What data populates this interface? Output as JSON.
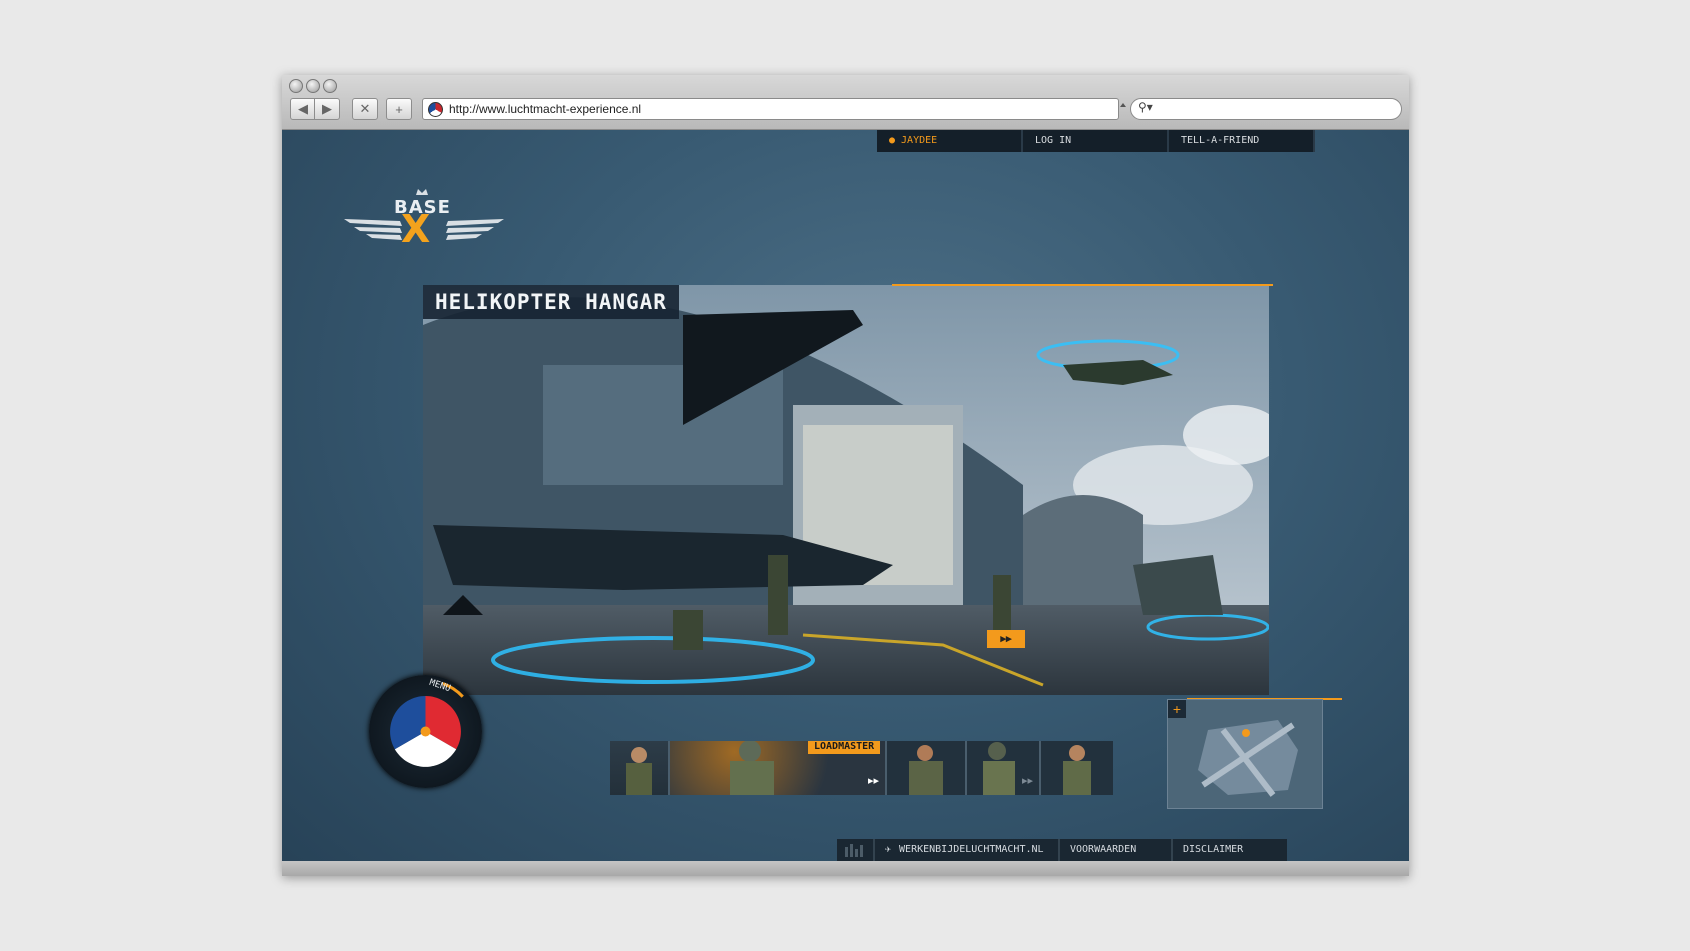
{
  "browser": {
    "url": "http://www.luchtmacht-experience.nl",
    "back_glyph": "◀",
    "forward_glyph": "▶",
    "stop_glyph": "✕",
    "add_glyph": "+",
    "search_glyph": "⚲▾"
  },
  "topnav": {
    "user_label": "JAYDEE",
    "login_label": "LOG IN",
    "tell_label": "TELL-A-FRIEND"
  },
  "logo": {
    "word": "BASE",
    "mark": "X"
  },
  "scene": {
    "title": "HELIKOPTER HANGAR",
    "ff_glyph": "▸▸"
  },
  "menu": {
    "label": "MENU",
    "colors": [
      "#c9272d",
      "#ffffff",
      "#1e4e9c"
    ]
  },
  "crew": {
    "active_label": "LOADMASTER",
    "arrows": "▸▸",
    "next_arrows": "▸▸"
  },
  "minimap": {
    "plus": "+"
  },
  "footer": {
    "link1": "WERKENBIJDELUCHTMACHT.NL",
    "link2": "VOORWAARDEN",
    "link3": "DISCLAIMER"
  },
  "colors": {
    "accent": "#f39a1c",
    "glow": "#2ec3ff",
    "panel": "#141f29"
  }
}
